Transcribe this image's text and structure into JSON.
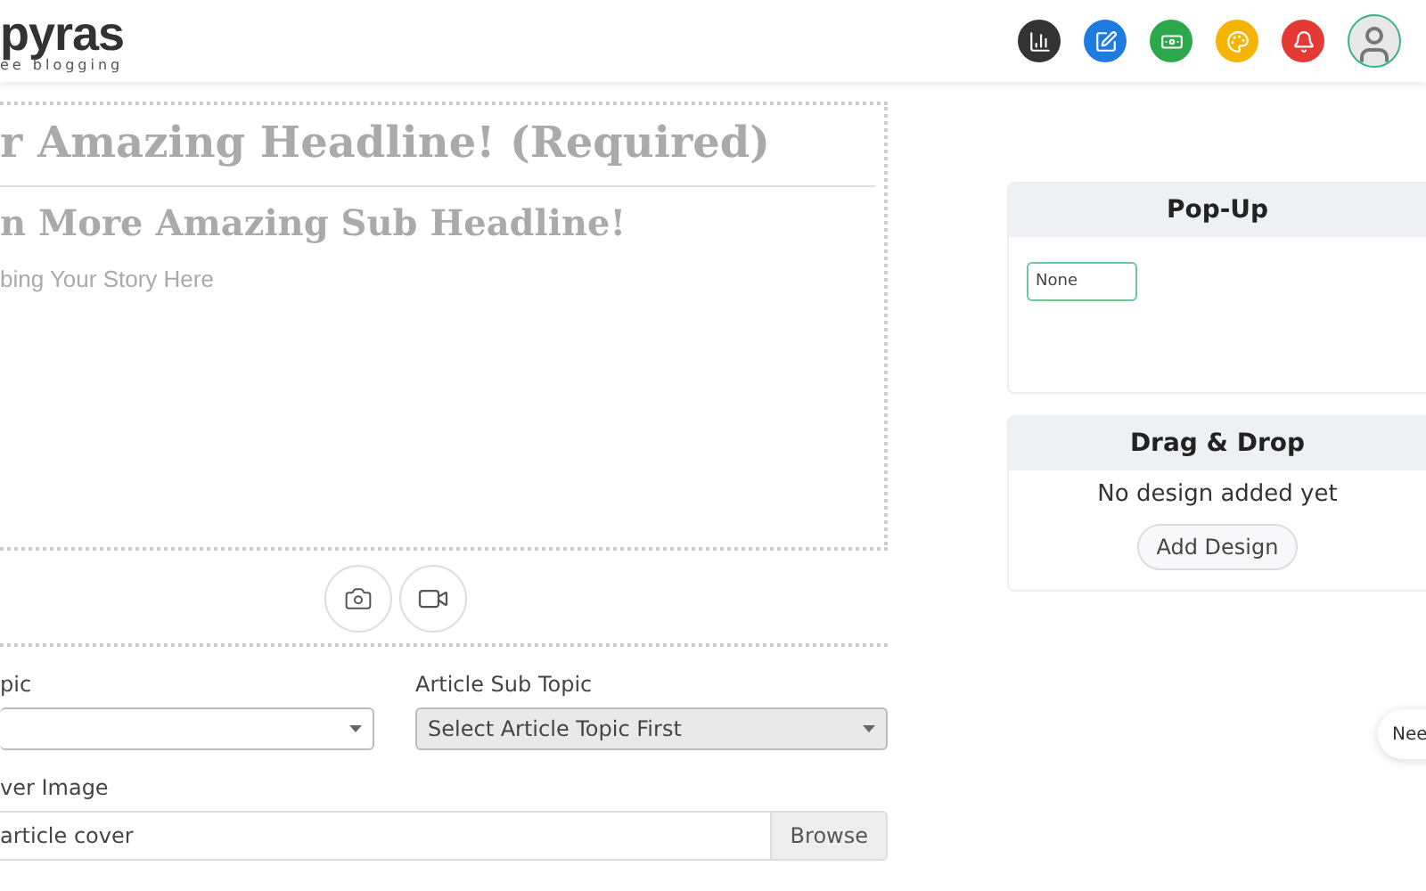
{
  "header": {
    "logo": {
      "name": "pyras",
      "tagline": "ee blogging"
    },
    "icons": [
      {
        "kind": "chart",
        "color": "#333333"
      },
      {
        "kind": "edit",
        "color": "#1e7be0"
      },
      {
        "kind": "money",
        "color": "#2ba84a"
      },
      {
        "kind": "palette",
        "color": "#f5b400"
      },
      {
        "kind": "bell",
        "color": "#e53935"
      },
      {
        "kind": "avatar",
        "color": "#3bb38a"
      }
    ]
  },
  "editor": {
    "headline": {
      "placeholder": "r Amazing Headline! (Required)"
    },
    "sub_headline": {
      "placeholder": "n More Amazing Sub Headline!"
    },
    "story": {
      "placeholder": "bing Your Story Here"
    },
    "media_buttons": [
      {
        "kind": "camera"
      },
      {
        "kind": "video"
      }
    ]
  },
  "form": {
    "topic": {
      "label": "pic"
    },
    "sub_topic": {
      "label": "Article Sub Topic",
      "value": "Select Article Topic First",
      "disabled": true
    },
    "cover": {
      "label": "ver Image",
      "placeholder": "article cover",
      "button": "Browse"
    }
  },
  "popup_card": {
    "title": "Pop-Up",
    "value": "None"
  },
  "drag_drop_card": {
    "title": "Drag & Drop",
    "message": "No design added yet",
    "button": "Add Design"
  },
  "chat_bubble": {
    "text": "Nee"
  }
}
